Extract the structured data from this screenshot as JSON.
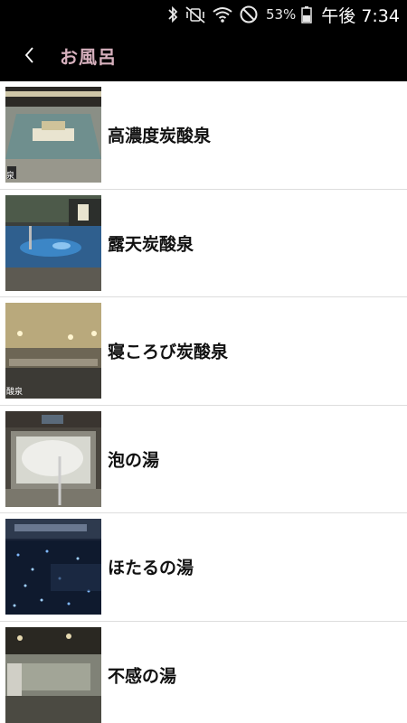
{
  "status_bar": {
    "battery_percent": "53%",
    "time": "午後 7:34",
    "icons": [
      "bluetooth-icon",
      "vibrate-mute-icon",
      "wifi-icon",
      "do-not-disturb-icon",
      "battery-icon"
    ]
  },
  "app_bar": {
    "title": "お風呂",
    "back_icon": "chevron-left-icon"
  },
  "colors": {
    "title_color": "#d6b0bd",
    "bar_background": "#000000"
  },
  "items": [
    {
      "label": "高濃度炭酸泉",
      "thumb_caption": "泉"
    },
    {
      "label": "露天炭酸泉"
    },
    {
      "label": "寝ころび炭酸泉",
      "thumb_caption": "酸泉"
    },
    {
      "label": "泡の湯"
    },
    {
      "label": "ほたるの湯"
    },
    {
      "label": "不感の湯"
    }
  ]
}
